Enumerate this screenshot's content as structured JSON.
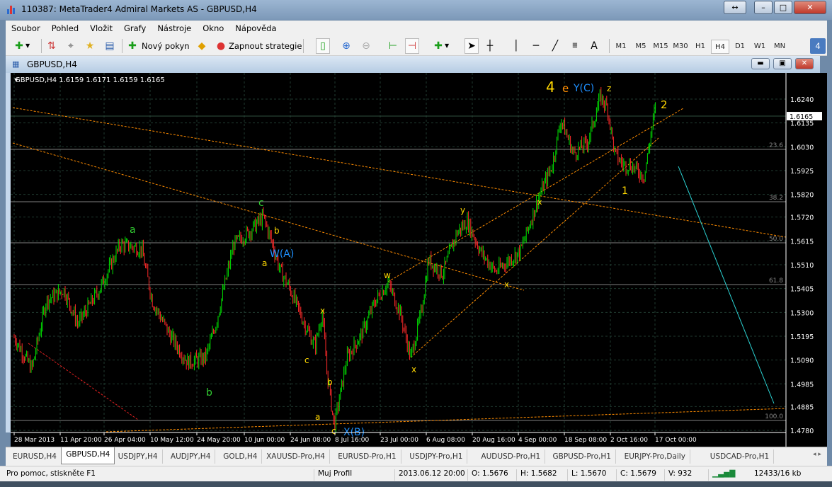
{
  "window": {
    "title": "110387: MetaTrader4 Admiral Markets AS - GBPUSD,H4"
  },
  "menu": [
    "Soubor",
    "Pohled",
    "Vložit",
    "Grafy",
    "Nástroje",
    "Okno",
    "Nápověda"
  ],
  "toolbar": {
    "new_order": "Nový pokyn",
    "strategies": "Zapnout strategie",
    "text_tool": "A",
    "timeframes": [
      "M1",
      "M5",
      "M15",
      "M30",
      "H1",
      "H4",
      "D1",
      "W1",
      "MN"
    ],
    "active_timeframe": "H4",
    "notifications": "4"
  },
  "chart_window": {
    "title": "GBPUSD,H4"
  },
  "chart": {
    "header": "GBPUSD,H4  1.6159 1.6171 1.6159 1.6165",
    "current_price": "1.6165",
    "colors": {
      "bull": "#00e000",
      "bear": "#ff2a2a",
      "fib": "#808080",
      "trend": "#ff8c00",
      "cyan": "#2bd3d3"
    },
    "fib_levels": [
      "23.6",
      "38.2",
      "50.0",
      "61.8",
      "100.0"
    ],
    "wave_labels": [
      {
        "text": "4",
        "color": "#ffd700"
      },
      {
        "text": "e",
        "color": "#ff8c00"
      },
      {
        "text": "Y(C)",
        "color": "#1e90ff"
      },
      {
        "text": "z",
        "color": "#ffd700"
      },
      {
        "text": "2",
        "color": "#ffd700"
      },
      {
        "text": "1",
        "color": "#ffd700"
      },
      {
        "text": "y",
        "color": "#ffd700"
      },
      {
        "text": "w",
        "color": "#ffd700"
      },
      {
        "text": "x",
        "color": "#ffd700"
      },
      {
        "text": "x",
        "color": "#ffd700"
      },
      {
        "text": "x",
        "color": "#ffd700"
      },
      {
        "text": "x",
        "color": "#ffd700"
      },
      {
        "text": "a",
        "color": "#ffd700"
      },
      {
        "text": "b",
        "color": "#ffd700"
      },
      {
        "text": "c",
        "color": "#ffd700"
      },
      {
        "text": "a",
        "color": "#ffd700"
      },
      {
        "text": "b",
        "color": "#ffd700"
      },
      {
        "text": "c",
        "color": "#ffd700"
      },
      {
        "text": "W(A)",
        "color": "#1e90ff"
      },
      {
        "text": "X(B)",
        "color": "#1e90ff"
      },
      {
        "text": "a",
        "color": "#32cd32"
      },
      {
        "text": "b",
        "color": "#32cd32"
      },
      {
        "text": "c",
        "color": "#32cd32"
      }
    ]
  },
  "chart_data": {
    "type": "candlestick",
    "symbol": "GBPUSD",
    "timeframe": "H4",
    "ohlc_last": {
      "open": 1.6159,
      "high": 1.6171,
      "low": 1.6159,
      "close": 1.6165
    },
    "y_ticks": [
      "1.6240",
      "1.6135",
      "1.6030",
      "1.5925",
      "1.5820",
      "1.5720",
      "1.5615",
      "1.5510",
      "1.5405",
      "1.5300",
      "1.5195",
      "1.5090",
      "1.4985",
      "1.4885",
      "1.4780"
    ],
    "ylim": [
      1.478,
      1.624
    ],
    "x_ticks": [
      "28 Mar 2013",
      "11 Apr 20:00",
      "26 Apr 04:00",
      "10 May 12:00",
      "24 May 20:00",
      "10 Jun 00:00",
      "24 Jun 08:00",
      "8 Jul 16:00",
      "23 Jul 00:00",
      "6 Aug 08:00",
      "20 Aug 16:00",
      "4 Sep 00:00",
      "18 Sep 08:00",
      "2 Oct 16:00",
      "17 Oct 00:00"
    ],
    "grid": true
  },
  "tabs": [
    "EURUSD,H4",
    "GBPUSD,H4",
    "USDJPY,H4",
    "AUDJPY,H4",
    "GOLD,H4",
    "XAUUSD-Pro,H4",
    "EURUSD-Pro,H1",
    "USDJPY-Pro,H1",
    "AUDUSD-Pro,H1",
    "GBPUSD-Pro,H1",
    "EURJPY-Pro,Daily",
    "USDCAD-Pro,H1"
  ],
  "active_tab": "GBPUSD,H4",
  "status": {
    "help": "Pro pomoc, stiskněte F1",
    "profile": "Muj Profil",
    "datetime": "2013.06.12 20:00",
    "open": "O: 1.5676",
    "high": "H: 1.5682",
    "low": "L: 1.5670",
    "close": "C: 1.5679",
    "volume": "V: 932",
    "traffic": "12433/16 kb"
  }
}
